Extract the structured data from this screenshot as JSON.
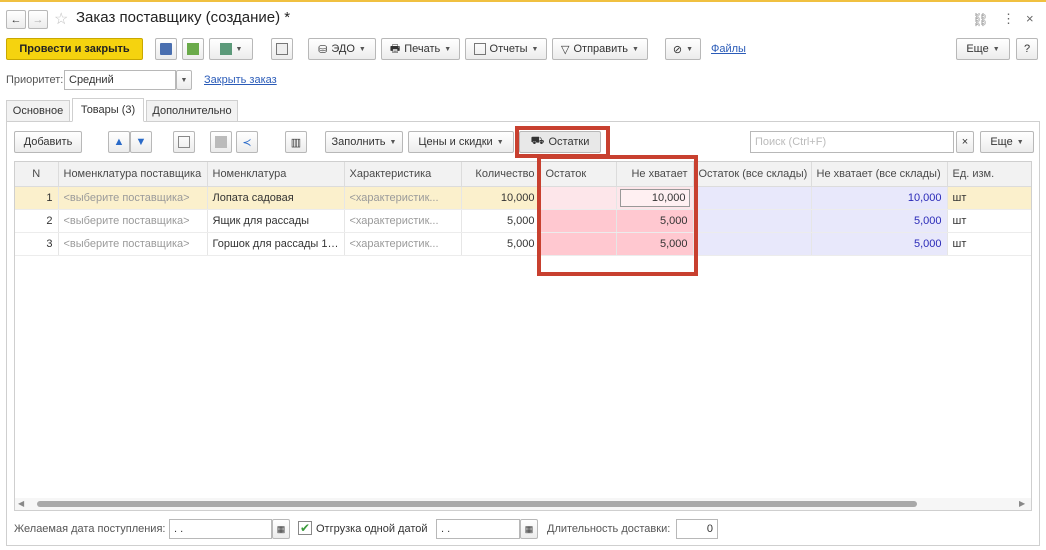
{
  "window": {
    "title": "Заказ поставщику (создание) *",
    "more_icon": "⋮",
    "close_icon": "×",
    "link_icon": "chain-link"
  },
  "toolbar": {
    "post_close": "Провести и закрыть",
    "edo": "ЭДО",
    "print": "Печать",
    "reports": "Отчеты",
    "send": "Отправить",
    "files": "Файлы",
    "more": "Еще",
    "help": "?"
  },
  "priority": {
    "label": "Приоритет:",
    "value": "Средний",
    "close_order": "Закрыть заказ"
  },
  "tabs": [
    {
      "label": "Основное"
    },
    {
      "label": "Товары (3)"
    },
    {
      "label": "Дополнительно"
    }
  ],
  "grid_toolbar": {
    "add": "Добавить",
    "fill": "Заполнить",
    "prices": "Цены и скидки",
    "stock": "Остатки",
    "search_placeholder": "Поиск (Ctrl+F)",
    "clear": "×",
    "more": "Еще"
  },
  "table": {
    "columns": [
      "N",
      "Номенклатура поставщика",
      "Номенклатура",
      "Характеристика",
      "Количество",
      "Остаток",
      "Не хватает",
      "Остаток (все склады)",
      "Не хватает (все склады)",
      "Ед. изм."
    ],
    "rows": [
      {
        "n": "1",
        "supplier_item": "<выберите поставщика>",
        "item": "Лопата садовая",
        "characteristic": "<характеристик...",
        "qty": "10,000",
        "stock": "",
        "shortage": "10,000",
        "stock_all": "",
        "shortage_all": "10,000",
        "unit": "шт"
      },
      {
        "n": "2",
        "supplier_item": "<выберите поставщика>",
        "item": "Ящик для рассады",
        "characteristic": "<характеристик...",
        "qty": "5,000",
        "stock": "",
        "shortage": "5,000",
        "stock_all": "",
        "shortage_all": "5,000",
        "unit": "шт"
      },
      {
        "n": "3",
        "supplier_item": "<выберите поставщика>",
        "item": "Горшок для рассады 10...",
        "characteristic": "<характеристик...",
        "qty": "5,000",
        "stock": "",
        "shortage": "5,000",
        "stock_all": "",
        "shortage_all": "5,000",
        "unit": "шт"
      }
    ]
  },
  "footer": {
    "date_label": "Желаемая дата поступления:",
    "date_value": " .  .",
    "one_date_label": "Отгрузка одной датой",
    "one_date_value": " .  .",
    "duration_label": "Длительность доставки:",
    "duration_value": "0"
  },
  "colors": {
    "accent_yellow": "#f5d30f",
    "highlight_red": "#c8402f",
    "shortage_pink": "#ffc8d0",
    "selected_row": "#fbf0cc"
  }
}
